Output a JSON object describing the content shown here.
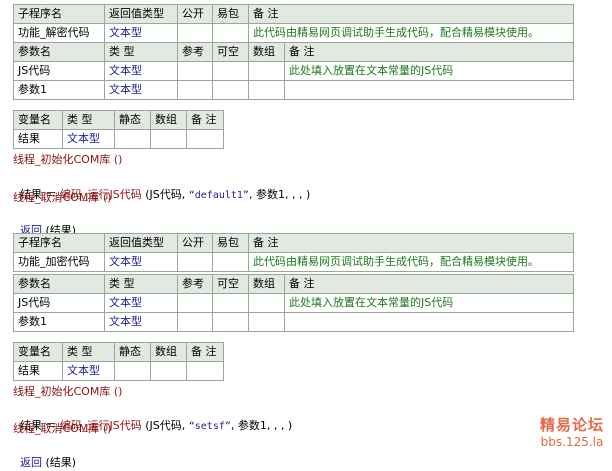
{
  "sub_header": {
    "name": "子程序名",
    "return_type": "返回值类型",
    "public": "公开",
    "easy_pkg": "易包",
    "remark": "备 注"
  },
  "param_header": {
    "name": "参数名",
    "type": "类 型",
    "ref": "参考",
    "nullable": "可空",
    "array": "数组",
    "remark": "备 注"
  },
  "var_header": {
    "name": "变量名",
    "type": "类 型",
    "static": "静态",
    "array": "数组",
    "remark": "备 注"
  },
  "blocks": [
    {
      "sub": {
        "name": "功能_解密代码",
        "return_type": "文本型",
        "remark": "此代码由精易网页调试助手生成代码，配合精易模块使用。"
      },
      "params": [
        {
          "name": "JS代码",
          "type": "文本型",
          "remark": "此处填入放置在文本常量的JS代码"
        },
        {
          "name": "参数1",
          "type": "文本型",
          "remark": ""
        }
      ],
      "vars": [
        {
          "name": "结果",
          "type": "文本型"
        }
      ],
      "code": {
        "line1": "线程_初始化COM库 ()",
        "line2_lhs": "结果 ＝ ",
        "line2_call": "编码_运行JS代码",
        "line2_args_a": " (JS代码, ",
        "line2_str": "“default1”",
        "line2_args_b": ", 参数1, , , )",
        "line3": "线程_取消COM库 ()",
        "line4_kw": "返回",
        "line4_rest": " (结果)"
      }
    },
    {
      "sub": {
        "name": "功能_加密代码",
        "return_type": "文本型",
        "remark": "此代码由精易网页调试助手生成代码，配合精易模块使用。"
      },
      "params": [
        {
          "name": "JS代码",
          "type": "文本型",
          "remark": "此处填入放置在文本常量的JS代码"
        },
        {
          "name": "参数1",
          "type": "文本型",
          "remark": ""
        }
      ],
      "vars": [
        {
          "name": "结果",
          "type": "文本型"
        }
      ],
      "code": {
        "line1": "线程_初始化COM库 ()",
        "line2_lhs": "结果 ＝ ",
        "line2_call": "编码_运行JS代码",
        "line2_args_a": " (JS代码, ",
        "line2_str": "“setsf”",
        "line2_args_b": ", 参数1, , , )",
        "line3": "线程_取消COM库 ()",
        "line4_kw": "返回",
        "line4_rest": " (结果)"
      }
    }
  ],
  "watermark": {
    "line1": "精易论坛",
    "line2": "bbs.125.la"
  }
}
